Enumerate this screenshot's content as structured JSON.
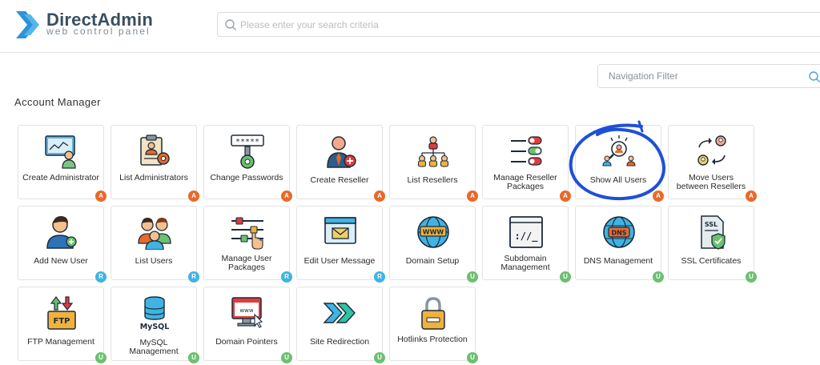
{
  "header": {
    "logo_title": "DirectAdmin",
    "logo_subtitle": "web control panel",
    "search_placeholder": "Please enter your search criteria"
  },
  "nav_filter": {
    "placeholder": "Navigation Filter"
  },
  "section": {
    "title": "Account Manager"
  },
  "badge_colors": {
    "A": "#e8692a",
    "R": "#3fb4e3",
    "U": "#6cc070"
  },
  "annotation": {
    "color": "#1f4fd8",
    "note": "hand-drawn circle around Show All Users"
  },
  "cards": [
    {
      "label": "Create Administrator",
      "badge": "A",
      "icon": "create-administrator-icon"
    },
    {
      "label": "List Administrators",
      "badge": "A",
      "icon": "list-administrators-icon"
    },
    {
      "label": "Change Passwords",
      "badge": "A",
      "icon": "change-passwords-icon"
    },
    {
      "label": "Create Reseller",
      "badge": "A",
      "icon": "create-reseller-icon"
    },
    {
      "label": "List Resellers",
      "badge": "A",
      "icon": "list-resellers-icon"
    },
    {
      "label": "Manage Reseller Packages",
      "badge": "A",
      "icon": "manage-reseller-packages-icon"
    },
    {
      "label": "Show All Users",
      "badge": "A",
      "icon": "show-all-users-icon"
    },
    {
      "label": "Move Users between Resellers",
      "badge": "A",
      "icon": "move-users-icon"
    },
    {
      "label": "Add New User",
      "badge": "R",
      "icon": "add-new-user-icon"
    },
    {
      "label": "List Users",
      "badge": "R",
      "icon": "list-users-icon"
    },
    {
      "label": "Manage User Packages",
      "badge": "R",
      "icon": "manage-user-packages-icon"
    },
    {
      "label": "Edit User Message",
      "badge": "R",
      "icon": "edit-user-message-icon"
    },
    {
      "label": "Domain Setup",
      "badge": "U",
      "icon": "domain-setup-icon"
    },
    {
      "label": "Subdomain Management",
      "badge": "U",
      "icon": "subdomain-management-icon"
    },
    {
      "label": "DNS Management",
      "badge": "U",
      "icon": "dns-management-icon"
    },
    {
      "label": "SSL Certificates",
      "badge": "U",
      "icon": "ssl-certificates-icon"
    },
    {
      "label": "FTP Management",
      "badge": "U",
      "icon": "ftp-management-icon"
    },
    {
      "label": "MySQL Management",
      "badge": "U",
      "icon": "mysql-management-icon"
    },
    {
      "label": "Domain Pointers",
      "badge": "U",
      "icon": "domain-pointers-icon"
    },
    {
      "label": "Site Redirection",
      "badge": "U",
      "icon": "site-redirection-icon"
    },
    {
      "label": "Hotlinks Protection",
      "badge": "U",
      "icon": "hotlinks-protection-icon"
    }
  ],
  "icon_text": {
    "password_mask": "*****",
    "www": "WWW",
    "dns": "DNS",
    "ssl": "SSL",
    "ftp": "FTP",
    "mysql": "MySQL",
    "terminal": "://_",
    "www_small": "www"
  }
}
